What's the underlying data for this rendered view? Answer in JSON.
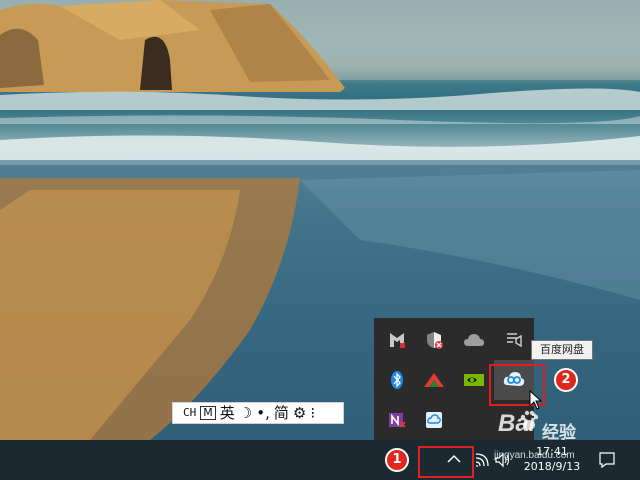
{
  "ime_bar": {
    "mode": "CH",
    "m_key": "M",
    "lang": "英",
    "moon": "☽",
    "punct": "•,",
    "script": "简",
    "settings": "⚙",
    "more": "⁝"
  },
  "tray_flyout": {
    "icons": [
      "mcafee-icon",
      "security-alert-icon",
      "onedrive-icon",
      "display-settings-icon",
      "bluetooth-icon",
      "red-app-icon",
      "nvidia-icon",
      "baidu-netdisk-icon",
      "onenote-icon",
      "cloud-sync-icon"
    ],
    "tooltip": "百度网盘"
  },
  "annotations": {
    "step1": "1",
    "step2": "2",
    "highlight_color": "#e02020"
  },
  "taskbar": {
    "time": "17:41",
    "date": "2018/9/13"
  },
  "watermark": {
    "logo": "Bai",
    "sub": "经验",
    "url": "jingyan.baidu.com"
  }
}
